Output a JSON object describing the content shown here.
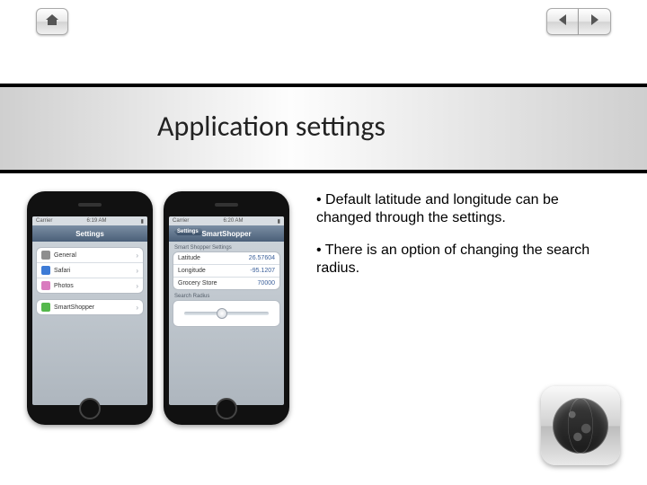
{
  "nav": {
    "home_icon": "home-icon",
    "prev_icon": "triangle-left-icon",
    "next_icon": "triangle-right-icon"
  },
  "title": "Application settings",
  "bullets": [
    "• Default latitude and longitude can be changed through the settings.",
    "• There is an option of changing the search radius."
  ],
  "phone1": {
    "status": {
      "carrier": "Carrier",
      "time": "6:19 AM"
    },
    "header": "Settings",
    "rows": [
      {
        "icon": "#8e8e8e",
        "label": "General"
      },
      {
        "icon": "#3d7bd6",
        "label": "Safari"
      },
      {
        "icon": "#d97bbf",
        "label": "Photos"
      },
      {
        "icon": "#55b84c",
        "label": "SmartShopper"
      }
    ]
  },
  "phone2": {
    "status": {
      "carrier": "Carrier",
      "time": "6:20 AM"
    },
    "back": "Settings",
    "header": "SmartShopper",
    "section1_label": "Smart Shopper Settings",
    "rows": [
      {
        "label": "Latitude",
        "value": "26.57604"
      },
      {
        "label": "Longitude",
        "value": "-95.1207"
      },
      {
        "label": "Grocery Store",
        "value": "70000"
      }
    ],
    "section2_label": "Search Radius",
    "slider_pos_pct": 38
  },
  "badge": {
    "icon": "globe-icon"
  }
}
